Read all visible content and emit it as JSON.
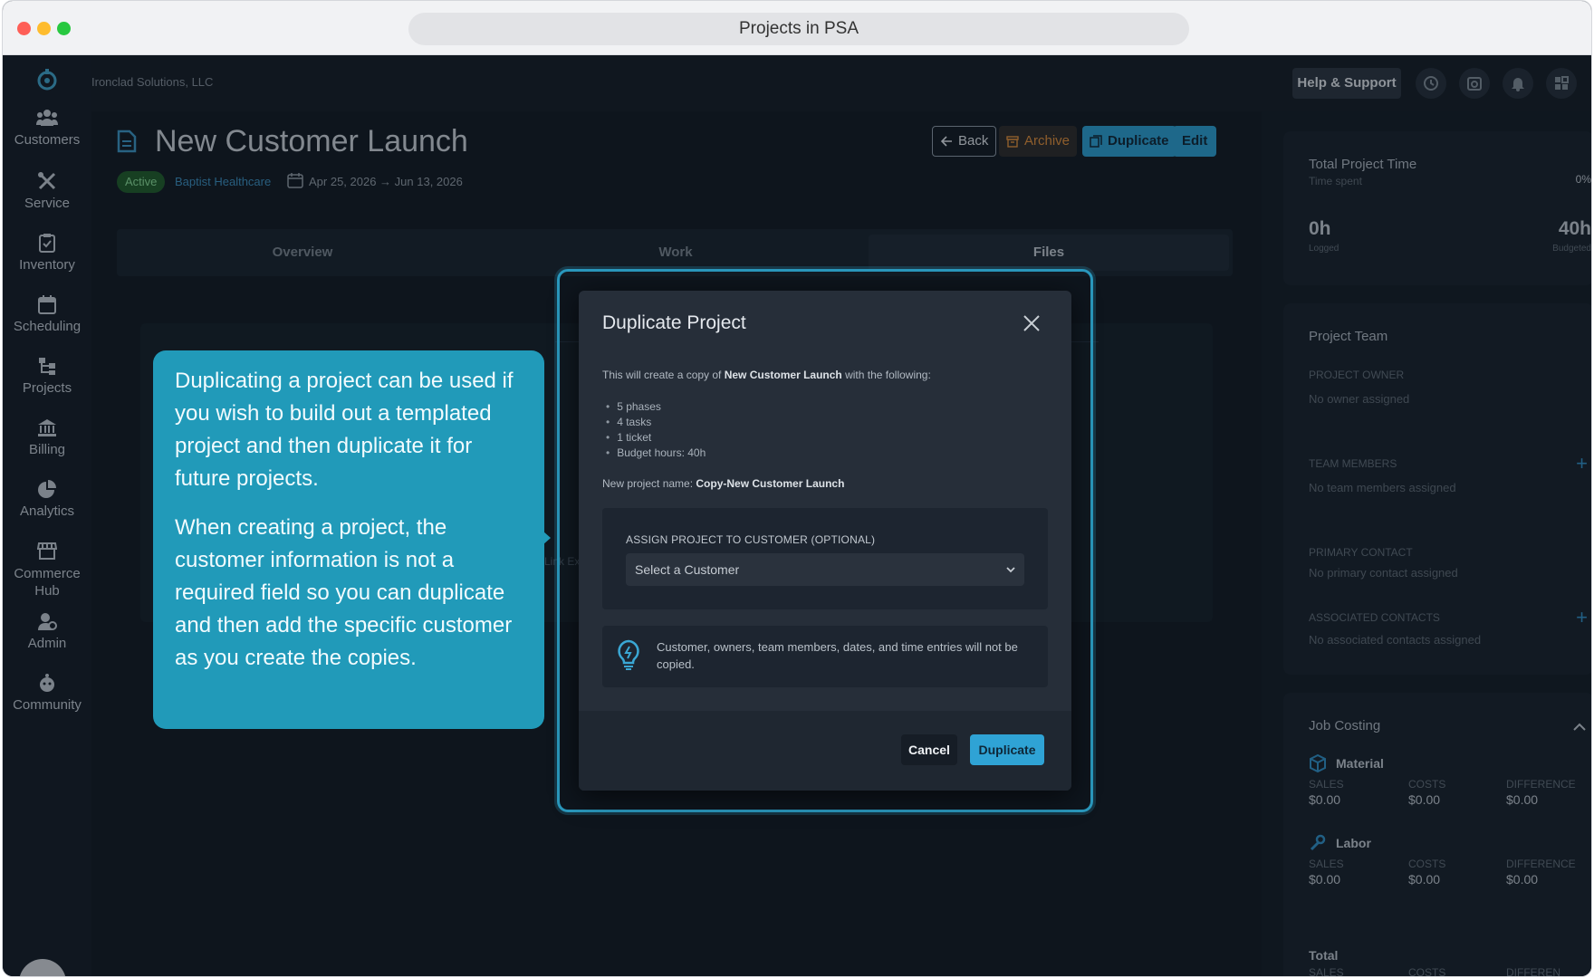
{
  "browser": {
    "url_title": "Projects in PSA"
  },
  "org_name": "Ironclad Solutions, LLC",
  "topbar": {
    "help_label": "Help & Support"
  },
  "nav": [
    {
      "label": "Customers",
      "icon": "users-icon"
    },
    {
      "label": "Service",
      "icon": "tools-icon"
    },
    {
      "label": "Inventory",
      "icon": "clipboard-check-icon"
    },
    {
      "label": "Scheduling",
      "icon": "calendar-icon"
    },
    {
      "label": "Projects",
      "icon": "hierarchy-icon"
    },
    {
      "label": "Billing",
      "icon": "bank-icon"
    },
    {
      "label": "Analytics",
      "icon": "pie-chart-icon"
    },
    {
      "label": "Commerce Hub",
      "icon": "store-icon"
    },
    {
      "label": "Admin",
      "icon": "user-gear-icon"
    },
    {
      "label": "Community",
      "icon": "community-icon"
    }
  ],
  "project": {
    "title": "New Customer Launch",
    "status": "Active",
    "customer": "Baptist Healthcare",
    "dates": "Apr 25, 2026 → Jun 13, 2026"
  },
  "header_buttons": {
    "back": "Back",
    "archive": "Archive",
    "duplicate": "Duplicate",
    "edit": "Edit"
  },
  "tabs": [
    {
      "label": "Overview",
      "active": false
    },
    {
      "label": "Work",
      "active": false
    },
    {
      "label": "Files",
      "active": true
    }
  ],
  "panel": {
    "link_fragment": "Link Ex"
  },
  "right_panel": {
    "time": {
      "title": "Total Project Time",
      "subtitle": "Time spent",
      "percent": "0%",
      "logged_value": "0h",
      "logged_label": "Logged",
      "budget_value": "40h",
      "budget_label": "Budgeted"
    },
    "team": {
      "title": "Project Team",
      "owner_label": "PROJECT OWNER",
      "owner_value": "No owner assigned",
      "members_label": "TEAM MEMBERS",
      "members_value": "No team members assigned",
      "primary_label": "PRIMARY CONTACT",
      "primary_value": "No primary contact assigned",
      "assoc_label": "ASSOCIATED CONTACTS",
      "assoc_value": "No associated contacts assigned"
    },
    "costing": {
      "title": "Job Costing",
      "sections": [
        {
          "name": "Material",
          "sales_label": "SALES",
          "sales": "$0.00",
          "costs_label": "COSTS",
          "costs": "$0.00",
          "diff_label": "DIFFERENCE",
          "diff": "$0.00"
        },
        {
          "name": "Labor",
          "sales_label": "SALES",
          "sales": "$0.00",
          "costs_label": "COSTS",
          "costs": "$0.00",
          "diff_label": "DIFFERENCE",
          "diff": "$0.00"
        }
      ],
      "total_label": "Total",
      "total_sales_label": "SALES",
      "total_costs_label": "COSTS",
      "total_diff_label": "DIFFEREN"
    }
  },
  "modal": {
    "title": "Duplicate Project",
    "desc_prefix": "This will create a copy of ",
    "desc_project": "New Customer Launch",
    "desc_suffix": " with the following:",
    "items": [
      "5 phases",
      "4 tasks",
      "1 ticket",
      "Budget hours: 40h"
    ],
    "name_prefix": "New project name: ",
    "name_value": "Copy-New Customer Launch",
    "assign_label": "ASSIGN PROJECT TO CUSTOMER (OPTIONAL)",
    "select_value": "Select a Customer",
    "note": "Customer, owners, team members, dates, and time entries will not be copied.",
    "cancel": "Cancel",
    "confirm": "Duplicate"
  },
  "tooltip": {
    "p1": "Duplicating a project can be used if you wish to build out a templated project and then duplicate it for future projects.",
    "p2": "When creating a project, the customer information is not a required field so you can duplicate and then add the specific customer as you create the copies."
  },
  "colors": {
    "accent": "#2fa3d5",
    "tooltip": "#219ab9",
    "archive": "#d7893a",
    "active_badge": "#1f5a2a"
  }
}
